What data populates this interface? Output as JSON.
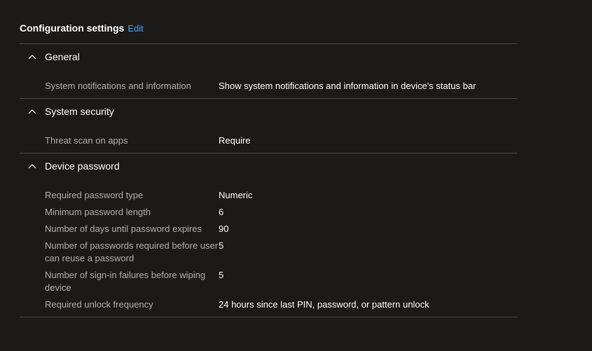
{
  "config": {
    "title": "Configuration settings",
    "edit_label": "Edit"
  },
  "sections": [
    {
      "title": "General",
      "rows": [
        {
          "label": "System notifications and information",
          "value": "Show system notifications and information in device's status bar"
        }
      ]
    },
    {
      "title": "System security",
      "rows": [
        {
          "label": "Threat scan on apps",
          "value": "Require"
        }
      ]
    },
    {
      "title": "Device password",
      "rows": [
        {
          "label": "Required password type",
          "value": "Numeric"
        },
        {
          "label": "Minimum password length",
          "value": "6"
        },
        {
          "label": "Number of days until password expires",
          "value": "90"
        },
        {
          "label": "Number of passwords required before user can reuse a password",
          "value": "5"
        },
        {
          "label": "Number of sign-in failures before wiping device",
          "value": "5"
        },
        {
          "label": "Required unlock frequency",
          "value": "24 hours since last PIN, password, or pattern unlock"
        }
      ]
    }
  ],
  "colors": {
    "background": "#1b1a19",
    "link": "#4fa3f7",
    "label": "#b3b0ad",
    "divider": "#4a4847"
  },
  "icons": {
    "section_toggle": "chevron-up-icon"
  }
}
